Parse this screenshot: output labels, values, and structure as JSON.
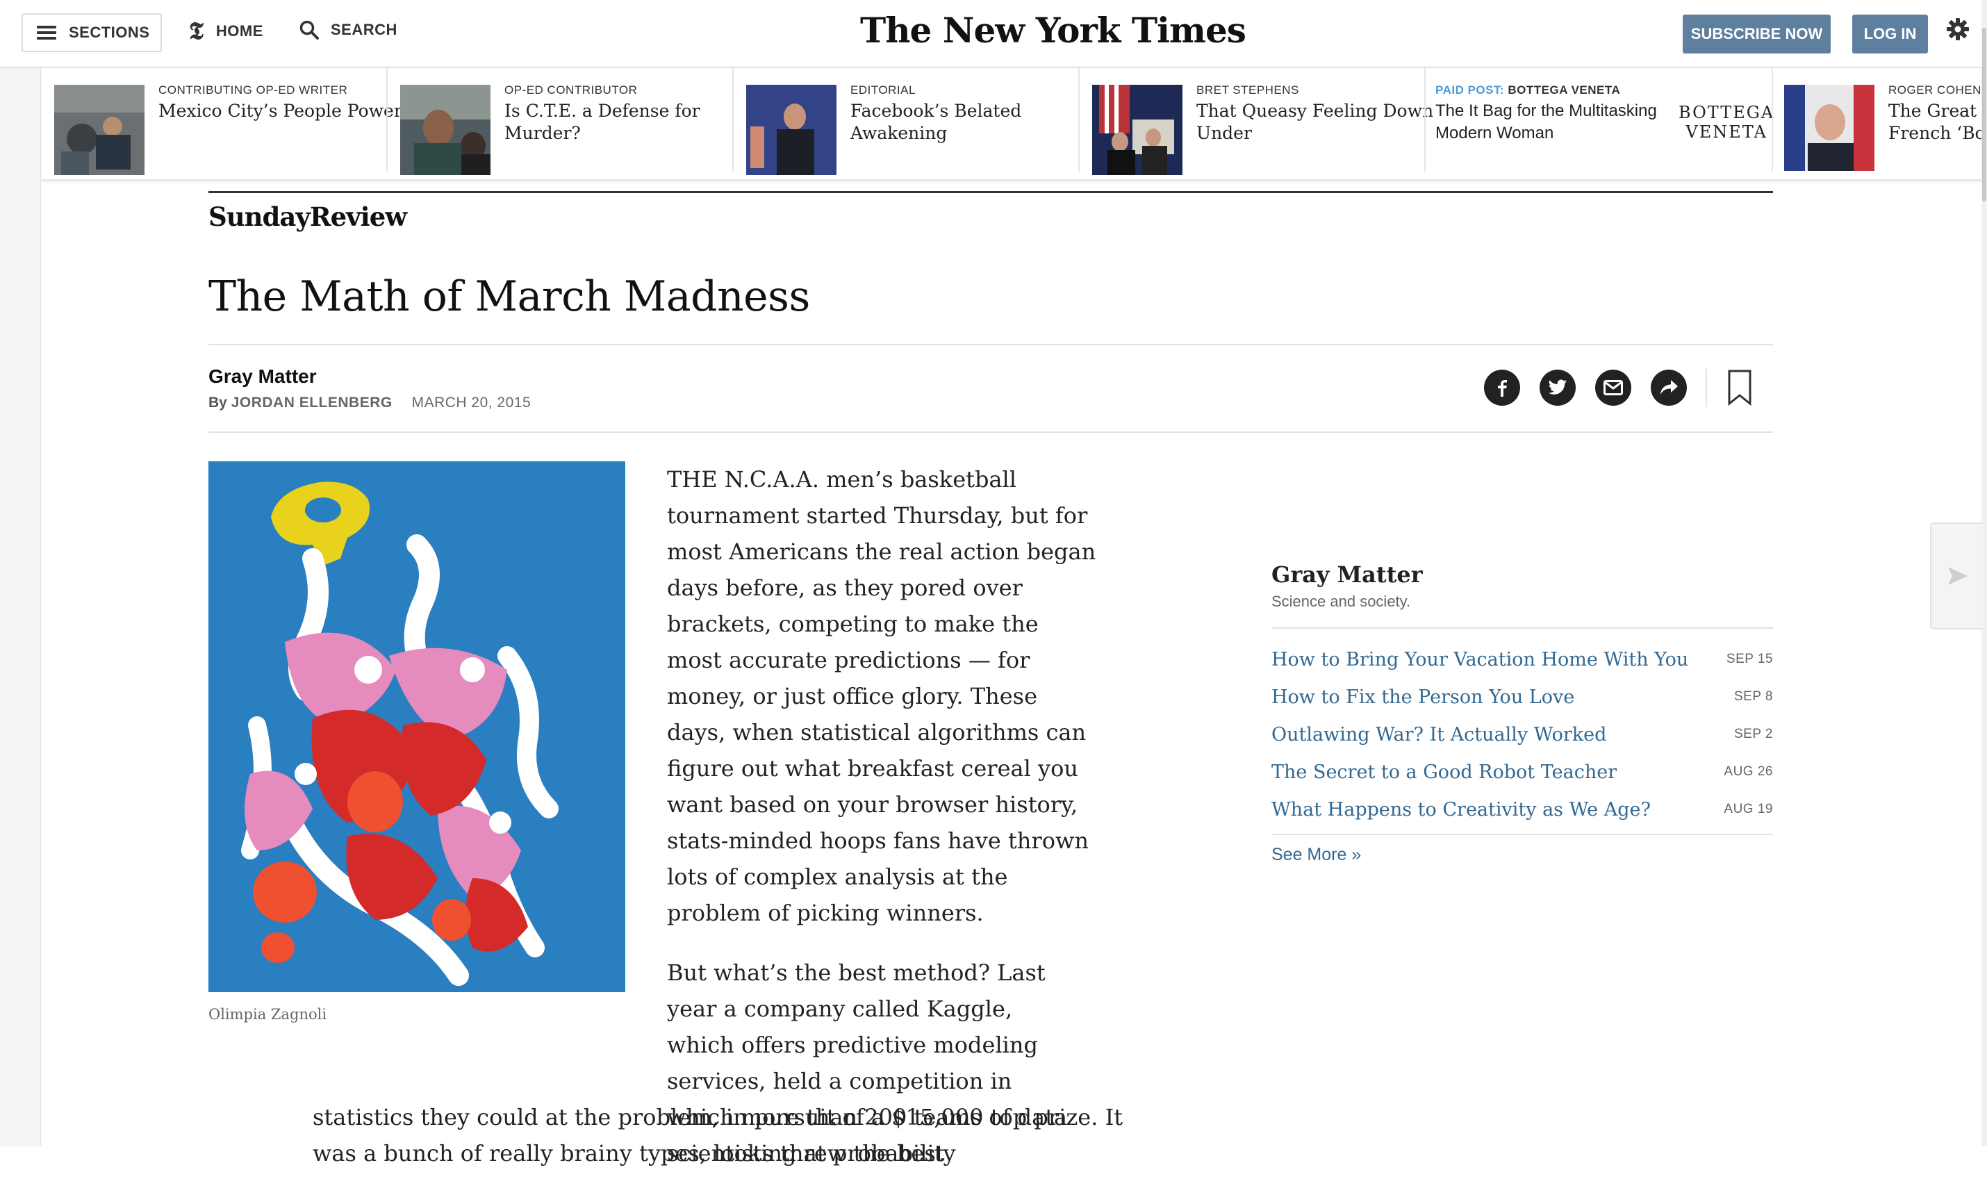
{
  "masthead": {
    "sections_label": "SECTIONS",
    "home_label": "HOME",
    "search_label": "SEARCH",
    "logo_text": "The New York Times",
    "subscribe_label": "SUBSCRIBE NOW",
    "login_label": "LOG IN"
  },
  "ribbon": {
    "items": [
      {
        "kicker": "CONTRIBUTING OP-ED WRITER",
        "headline_lines": [
          "Mexico City’s People Power"
        ]
      },
      {
        "kicker": "OP-ED CONTRIBUTOR",
        "headline_lines": [
          "Is C.T.E. a Defense for",
          "Murder?"
        ]
      },
      {
        "kicker": "EDITORIAL",
        "headline_lines": [
          "Facebook’s Belated",
          "Awakening"
        ]
      },
      {
        "kicker": "BRET STEPHENS",
        "headline_lines": [
          "That Queasy Feeling Down",
          "Under"
        ]
      },
      {
        "kicker_paid": "PAID POST:",
        "kicker_brand": "BOTTEGA VENETA",
        "headline_lines": [
          "The It Bag for the Multitasking",
          "Modern Woman"
        ],
        "brand_logo_lines": [
          "BOTTEGA",
          "VENETA"
        ]
      },
      {
        "kicker": "ROGER COHEN",
        "headline_lines": [
          "The Great a",
          "French ‘Bof"
        ]
      }
    ]
  },
  "article": {
    "section": "SundayReview",
    "headline": "The Math of March Madness",
    "column": "Gray Matter",
    "by": "By",
    "author": "JORDAN ELLENBERG",
    "date": "MARCH 20, 2015",
    "image_credit": "Olimpia Zagnoli",
    "paragraph_1": "THE N.C.A.A. men’s basketball tournament started Thursday, but for most Americans the real action began days before, as they pored over brackets, competing to make the most accurate predictions — for money, or just office glory. These days, when statistical algorithms can figure out what breakfast cereal you want based on your browser history, stats-minded hoops fans have thrown lots of complex analysis at the problem of picking winners.",
    "paragraph_2": "But what’s the best method? Last year a company called Kaggle, which offers predictive modeling services, held a competition in which more than 200 teams of data scientists threw the best",
    "paragraph_2_cont": "statistics they could at the problem, in pursuit of a $15,000 top prize. It",
    "paragraph_2_cut": "was a bunch of really brainy types, looking at probability"
  },
  "share": {
    "icons": [
      "facebook-icon",
      "twitter-icon",
      "email-icon",
      "share-icon",
      "bookmark-icon"
    ]
  },
  "sidebar": {
    "title": "Gray Matter",
    "subtitle": "Science and society.",
    "items": [
      {
        "title": "How to Bring Your Vacation Home With You",
        "date": "SEP 15"
      },
      {
        "title": "How to Fix the Person You Love",
        "date": "SEP 8"
      },
      {
        "title": "Outlawing War? It Actually Worked",
        "date": "SEP 2"
      },
      {
        "title": "The Secret to a Good Robot Teacher",
        "date": "AUG 26"
      },
      {
        "title": "What Happens to Creativity as We Age?",
        "date": "AUG 19"
      }
    ],
    "see_more": "See More »"
  },
  "colors": {
    "button_blue": "#5f7f9f",
    "link_blue": "#326891",
    "paid_blue": "#4e9ad6",
    "illustration_bg": "#2a7fc1"
  }
}
